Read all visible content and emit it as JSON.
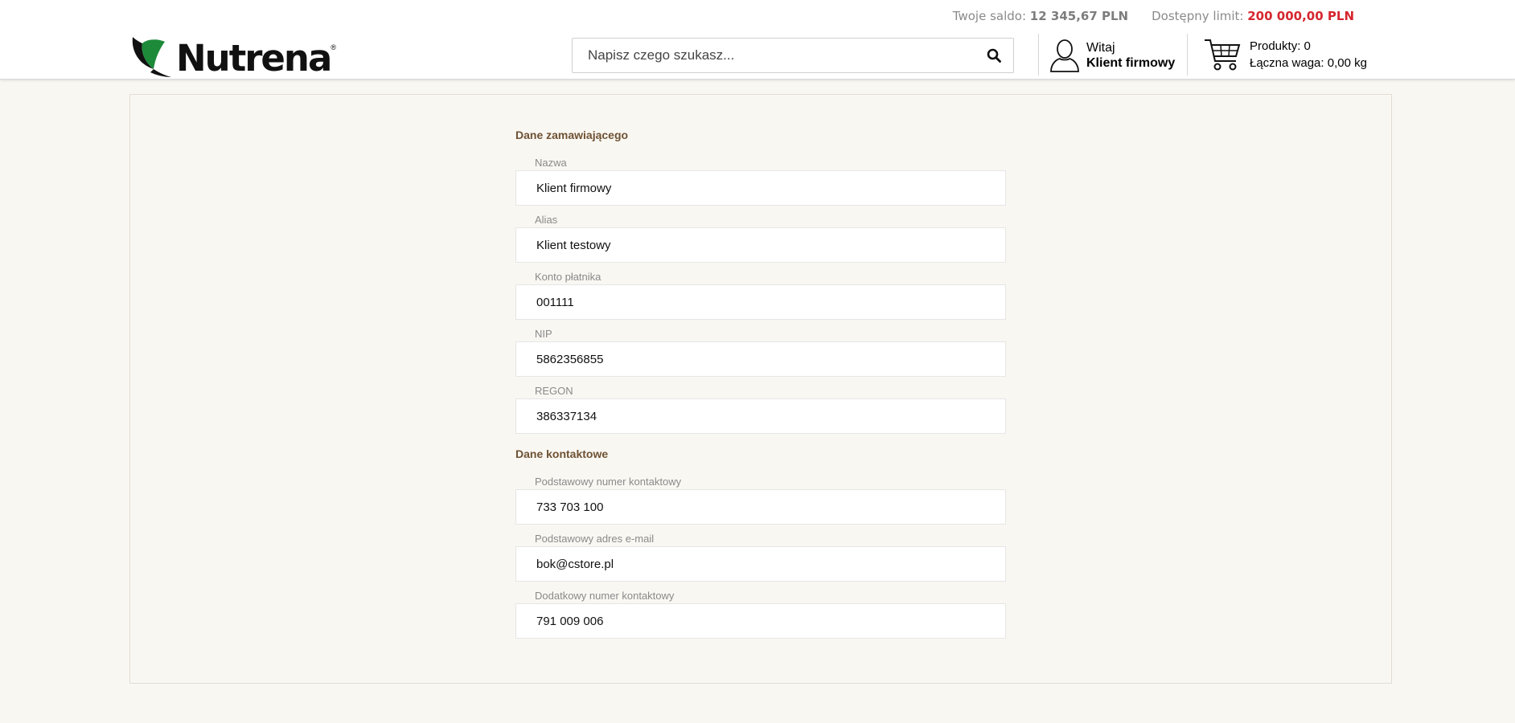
{
  "header": {
    "balance_label": "Twoje saldo:",
    "balance_value": "12 345,67 PLN",
    "limit_label": "Dostępny limit:",
    "limit_value": "200 000,00 PLN",
    "logo_text": "Nutrena",
    "logo_reg": "®",
    "search_placeholder": "Napisz czego szukasz...",
    "user_greeting": "Witaj",
    "user_name": "Klient firmowy",
    "cart_products": "Produkty: 0",
    "cart_weight": "Łączna waga: 0,00 kg"
  },
  "colors": {
    "accent_brown": "#6e5133",
    "limit_red": "#d6262f",
    "logo_green": "#1d8a3a",
    "background": "#f9f7f2"
  },
  "orderer": {
    "title": "Dane zamawiającego",
    "fields": [
      {
        "label": "Nazwa",
        "value": "Klient firmowy"
      },
      {
        "label": "Alias",
        "value": "Klient testowy"
      },
      {
        "label": "Konto płatnika",
        "value": "001111"
      },
      {
        "label": "NIP",
        "value": "5862356855"
      },
      {
        "label": "REGON",
        "value": "386337134"
      }
    ]
  },
  "contact": {
    "title": "Dane kontaktowe",
    "fields": [
      {
        "label": "Podstawowy numer kontaktowy",
        "value": "733 703 100"
      },
      {
        "label": "Podstawowy adres e-mail",
        "value": "bok@cstore.pl"
      },
      {
        "label": "Dodatkowy numer kontaktowy",
        "value": "791 009 006"
      }
    ]
  },
  "icons": {
    "logo": "leaf-logo-icon",
    "search": "search-icon",
    "user": "user-icon",
    "cart": "cart-icon"
  }
}
